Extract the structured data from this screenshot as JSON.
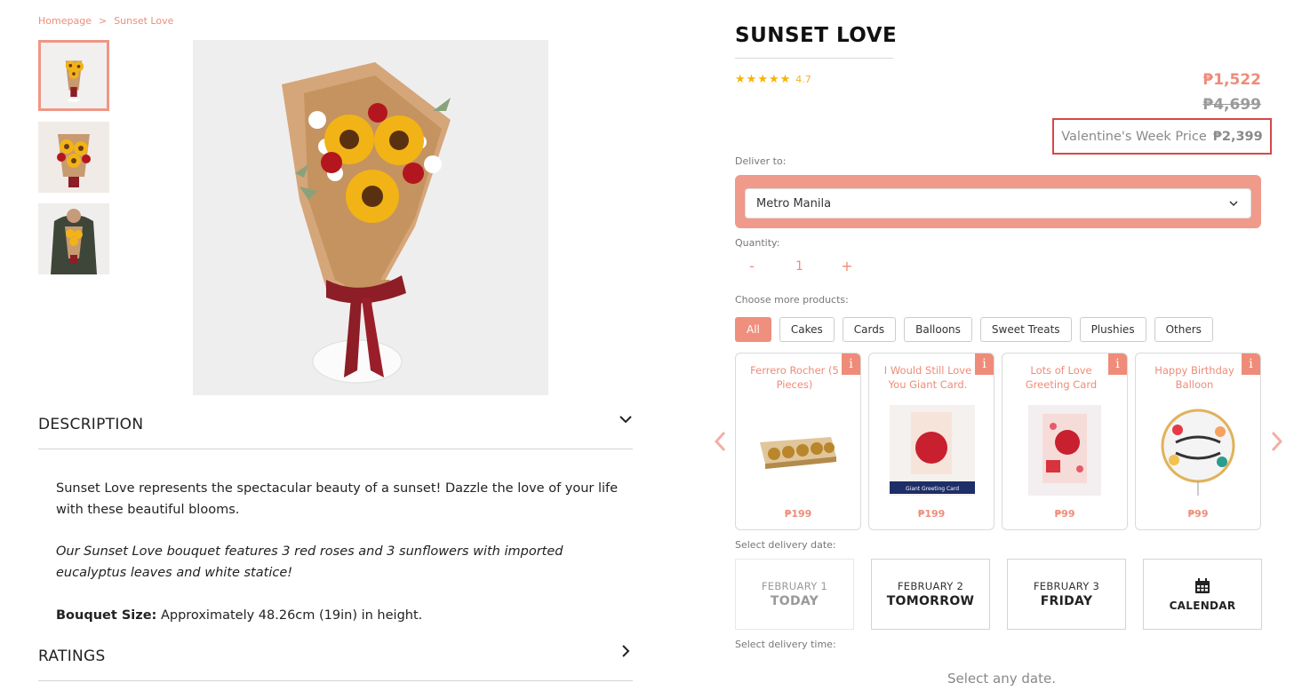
{
  "breadcrumb": [
    "Homepage",
    ">",
    "Sunset Love"
  ],
  "product": {
    "title": "SUNSET LOVE",
    "rating": "4.7",
    "sale_price": "₱1,522",
    "original_price": "₱4,699",
    "valentine_label": "Valentine's Week Price",
    "valentine_price": "₱2,399"
  },
  "description": {
    "heading": "DESCRIPTION",
    "para1": "Sunset Love represents the spectacular beauty of a sunset! Dazzle the love of your life with these beautiful blooms.",
    "para2": "Our Sunset Love bouquet features 3 red roses and 3 sunflowers with imported eucalyptus leaves and white statice!",
    "size_label": "Bouquet Size:",
    "size_value": " Approximately 48.26cm (19in) in height."
  },
  "ratings_heading": "RATINGS",
  "delivery": {
    "label": "Deliver to:",
    "location": "Metro Manila"
  },
  "quantity": {
    "label": "Quantity:",
    "minus": "-",
    "value": "1",
    "plus": "+"
  },
  "more_products": {
    "label": "Choose more products:",
    "filters": [
      "All",
      "Cakes",
      "Cards",
      "Balloons",
      "Sweet Treats",
      "Plushies",
      "Others"
    ],
    "items": [
      {
        "name": "Ferrero Rocher (5 Pieces)",
        "price": "₱199"
      },
      {
        "name": "I Would Still Love You Giant Card.",
        "price": "₱199"
      },
      {
        "name": "Lots of Love Greeting Card",
        "price": "₱99"
      },
      {
        "name": "Happy Birthday Balloon",
        "price": "₱99"
      }
    ],
    "info_glyph": "i",
    "card_caption": "Giant Greeting Card"
  },
  "delivery_date": {
    "label": "Select delivery date:",
    "options": [
      {
        "month": "FEBRUARY 1",
        "day": "TODAY"
      },
      {
        "month": "FEBRUARY 2",
        "day": "TOMORROW"
      },
      {
        "month": "FEBRUARY 3",
        "day": "FRIDAY"
      },
      {
        "month": "",
        "day": "CALENDAR"
      }
    ]
  },
  "delivery_time": {
    "label": "Select delivery time:",
    "placeholder": "Select any date."
  },
  "colors": {
    "accent": "#ee8c79",
    "highlight_border": "#d64848",
    "star": "#f7b500"
  },
  "icons": [
    "chevron-down-icon",
    "chevron-right-icon",
    "chevron-left-icon",
    "star-icon",
    "info-icon",
    "calendar-icon"
  ]
}
